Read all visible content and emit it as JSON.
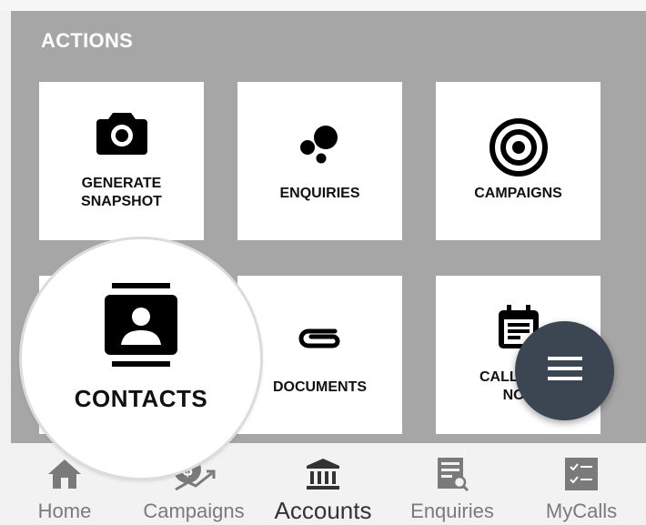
{
  "section_title": "ACTIONS",
  "tiles": {
    "snapshot": {
      "label": "GENERATE\nSNAPSHOT",
      "icon": "camera-icon"
    },
    "enquiries": {
      "label": "ENQUIRIES",
      "icon": "bubbles-icon"
    },
    "campaigns": {
      "label": "CAMPAIGNS",
      "icon": "target-icon"
    },
    "contacts": {
      "label": "CONTACTS",
      "icon": "contact-book-icon"
    },
    "documents": {
      "label": "DOCUMENTS",
      "icon": "paperclip-icon"
    },
    "call_history": {
      "label": "CALL H      \nNOT",
      "icon": "calendar-note-icon"
    }
  },
  "magnifier": {
    "label": "CONTACTS",
    "icon": "contact-book-icon"
  },
  "fab": {
    "icon": "menu-icon",
    "color": "#3c4652"
  },
  "bottom_nav": [
    {
      "label": "Home",
      "icon": "home-icon"
    },
    {
      "label": "Campaigns",
      "icon": "campaigns-dollar-icon"
    },
    {
      "label": "Accounts",
      "icon": "bank-icon",
      "active": true
    },
    {
      "label": "Enquiries",
      "icon": "enquiries-list-icon"
    },
    {
      "label": "MyCalls",
      "icon": "checklist-icon"
    }
  ],
  "colors": {
    "panel": "#a6a6a6",
    "tile": "#ffffff",
    "nav_bg": "#f2f2f2"
  }
}
